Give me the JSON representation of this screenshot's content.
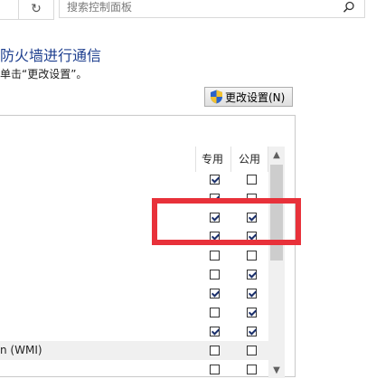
{
  "topbar": {
    "back_icon_glyph": "",
    "refresh_icon_glyph": "↻",
    "search_placeholder": "搜索控制面板"
  },
  "title": "防火墙进行通信",
  "hint": "单击“更改设置”。",
  "change_settings_label": "更改设置(N)",
  "columns": {
    "private": "专用",
    "public": "公用"
  },
  "rows": [
    {
      "label": "",
      "private": true,
      "public": false
    },
    {
      "label": "",
      "private": true,
      "public": false
    },
    {
      "label": "",
      "private": true,
      "public": true
    },
    {
      "label": "",
      "private": true,
      "public": true
    },
    {
      "label": "",
      "private": false,
      "public": false
    },
    {
      "label": "",
      "private": false,
      "public": true
    },
    {
      "label": "",
      "private": true,
      "public": true
    },
    {
      "label": "",
      "private": false,
      "public": true
    },
    {
      "label": "",
      "private": true,
      "public": true
    },
    {
      "label": "n (WMI)",
      "private": false,
      "public": false
    },
    {
      "label": "",
      "private": false,
      "public": false
    }
  ],
  "colors": {
    "title": "#1e3f8f",
    "annotation": "#e8313a"
  }
}
